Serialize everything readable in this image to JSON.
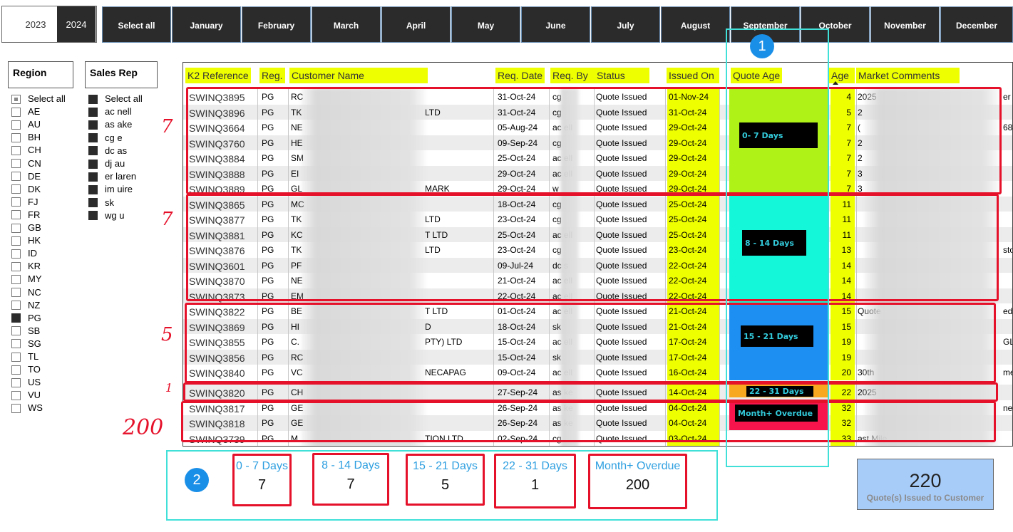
{
  "years": [
    "2023",
    "2024"
  ],
  "selected_year": "2024",
  "months": [
    "Select all",
    "January",
    "February",
    "March",
    "April",
    "May",
    "June",
    "July",
    "August",
    "September",
    "October",
    "November",
    "December"
  ],
  "region": {
    "title": "Region",
    "items": [
      {
        "label": "Select all",
        "state": "part"
      },
      {
        "label": "AE",
        "state": "off"
      },
      {
        "label": "AU",
        "state": "off"
      },
      {
        "label": "BH",
        "state": "off"
      },
      {
        "label": "CH",
        "state": "off"
      },
      {
        "label": "CN",
        "state": "off"
      },
      {
        "label": "DE",
        "state": "off"
      },
      {
        "label": "DK",
        "state": "off"
      },
      {
        "label": "FJ",
        "state": "off"
      },
      {
        "label": "FR",
        "state": "off"
      },
      {
        "label": "GB",
        "state": "off"
      },
      {
        "label": "HK",
        "state": "off"
      },
      {
        "label": "ID",
        "state": "off"
      },
      {
        "label": "KR",
        "state": "off"
      },
      {
        "label": "MY",
        "state": "off"
      },
      {
        "label": "NC",
        "state": "off"
      },
      {
        "label": "NZ",
        "state": "off"
      },
      {
        "label": "PG",
        "state": "on"
      },
      {
        "label": "SB",
        "state": "off"
      },
      {
        "label": "SG",
        "state": "off"
      },
      {
        "label": "TL",
        "state": "off"
      },
      {
        "label": "TO",
        "state": "off"
      },
      {
        "label": "US",
        "state": "off"
      },
      {
        "label": "VU",
        "state": "off"
      },
      {
        "label": "WS",
        "state": "off"
      }
    ]
  },
  "sales_rep": {
    "title": "Sales Rep",
    "items": [
      {
        "label": "Select all",
        "state": "on"
      },
      {
        "label": "ac    nell",
        "state": "on"
      },
      {
        "label": "as    ake",
        "state": "on"
      },
      {
        "label": "cg    e",
        "state": "on"
      },
      {
        "label": "dc    as",
        "state": "on"
      },
      {
        "label": "dj    au",
        "state": "on"
      },
      {
        "label": "er    laren",
        "state": "on"
      },
      {
        "label": "im    uire",
        "state": "on"
      },
      {
        "label": "sk",
        "state": "on"
      },
      {
        "label": "wg    u",
        "state": "on"
      }
    ]
  },
  "table": {
    "headers": {
      "ref": "K2 Reference",
      "reg": "Reg.",
      "customer": "Customer Name",
      "req_date": "Req. Date",
      "req_by": "Req. By",
      "status": "Status",
      "issued_on": "Issued On",
      "quote_age": "Quote Age",
      "age": "Age",
      "comments": "Market Comments"
    },
    "rows": [
      {
        "ref": "SWINQ3895",
        "reg": "PG",
        "cust": "RC",
        "cust_end": "",
        "date": "31-Oct-24",
        "by": "cg",
        "status": "Quote Issued",
        "issued": "01-Nov-24",
        "age": "4",
        "comment": "2025"
      },
      {
        "ref": "SWINQ3896",
        "reg": "PG",
        "cust": "TK",
        "cust_end": "LTD",
        "date": "31-Oct-24",
        "by": "cg",
        "status": "Quote Issued",
        "issued": "31-Oct-24",
        "age": "5",
        "comment": "2"
      },
      {
        "ref": "SWINQ3664",
        "reg": "PG",
        "cust": "NE",
        "cust_end": "",
        "date": "05-Aug-24",
        "by": "ac    ell",
        "status": "Quote Issued",
        "issued": "29-Oct-24",
        "age": "7",
        "comment": "("
      },
      {
        "ref": "SWINQ3760",
        "reg": "PG",
        "cust": "HE",
        "cust_end": "",
        "date": "09-Sep-24",
        "by": "cg",
        "status": "Quote Issued",
        "issued": "29-Oct-24",
        "age": "7",
        "comment": "2"
      },
      {
        "ref": "SWINQ3884",
        "reg": "PG",
        "cust": "SM",
        "cust_end": "",
        "date": "25-Oct-24",
        "by": "ac    ell",
        "status": "Quote Issued",
        "issued": "29-Oct-24",
        "age": "7",
        "comment": "2"
      },
      {
        "ref": "SWINQ3888",
        "reg": "PG",
        "cust": "EI",
        "cust_end": "",
        "date": "29-Oct-24",
        "by": "ac    ell",
        "status": "Quote Issued",
        "issued": "29-Oct-24",
        "age": "7",
        "comment": "3"
      },
      {
        "ref": "SWINQ3889",
        "reg": "PG",
        "cust": "GL",
        "cust_end": "MARK",
        "date": "29-Oct-24",
        "by": "w",
        "status": "Quote Issued",
        "issued": "29-Oct-24",
        "age": "7",
        "comment": "3"
      },
      {
        "ref": "SWINQ3865",
        "reg": "PG",
        "cust": "MC",
        "cust_end": "",
        "date": "18-Oct-24",
        "by": "cg",
        "status": "Quote Issued",
        "issued": "25-Oct-24",
        "age": "11",
        "comment": ""
      },
      {
        "ref": "SWINQ3877",
        "reg": "PG",
        "cust": "TK",
        "cust_end": "LTD",
        "date": "23-Oct-24",
        "by": "cg",
        "status": "Quote Issued",
        "issued": "25-Oct-24",
        "age": "11",
        "comment": ""
      },
      {
        "ref": "SWINQ3881",
        "reg": "PG",
        "cust": "KC",
        "cust_end": "T LTD",
        "date": "25-Oct-24",
        "by": "ac    ell",
        "status": "Quote Issued",
        "issued": "25-Oct-24",
        "age": "11",
        "comment": ""
      },
      {
        "ref": "SWINQ3876",
        "reg": "PG",
        "cust": "TK",
        "cust_end": "LTD",
        "date": "23-Oct-24",
        "by": "cg",
        "status": "Quote Issued",
        "issued": "23-Oct-24",
        "age": "13",
        "comment": ""
      },
      {
        "ref": "SWINQ3601",
        "reg": "PG",
        "cust": "PF",
        "cust_end": "",
        "date": "09-Jul-24",
        "by": "dc    s",
        "status": "Quote Issued",
        "issued": "22-Oct-24",
        "age": "14",
        "comment": ""
      },
      {
        "ref": "SWINQ3870",
        "reg": "PG",
        "cust": "NE",
        "cust_end": "",
        "date": "21-Oct-24",
        "by": "ac    ell",
        "status": "Quote Issued",
        "issued": "22-Oct-24",
        "age": "14",
        "comment": ""
      },
      {
        "ref": "SWINQ3873",
        "reg": "PG",
        "cust": "EM",
        "cust_end": "",
        "date": "22-Oct-24",
        "by": "ac    ell",
        "status": "Quote Issued",
        "issued": "22-Oct-24",
        "age": "14",
        "comment": ""
      },
      {
        "ref": "SWINQ3822",
        "reg": "PG",
        "cust": "BE",
        "cust_end": "T LTD",
        "date": "01-Oct-24",
        "by": "ac    ell",
        "status": "Quote Issued",
        "issued": "21-Oct-24",
        "age": "15",
        "comment": "Quote"
      },
      {
        "ref": "SWINQ3869",
        "reg": "PG",
        "cust": "HI",
        "cust_end": "D",
        "date": "18-Oct-24",
        "by": "sk",
        "status": "Quote Issued",
        "issued": "21-Oct-24",
        "age": "15",
        "comment": ""
      },
      {
        "ref": "SWINQ3855",
        "reg": "PG",
        "cust": "C.",
        "cust_end": "PTY) LTD",
        "date": "15-Oct-24",
        "by": "ac    ell",
        "status": "Quote Issued",
        "issued": "17-Oct-24",
        "age": "19",
        "comment": ""
      },
      {
        "ref": "SWINQ3856",
        "reg": "PG",
        "cust": "RC",
        "cust_end": "",
        "date": "15-Oct-24",
        "by": "sk",
        "status": "Quote Issued",
        "issued": "17-Oct-24",
        "age": "19",
        "comment": ""
      },
      {
        "ref": "SWINQ3840",
        "reg": "PG",
        "cust": "VC",
        "cust_end": "NECAPAG",
        "date": "09-Oct-24",
        "by": "ac    ell",
        "status": "Quote Issued",
        "issued": "16-Oct-24",
        "age": "20",
        "comment": "30th"
      },
      {
        "ref": "SWINQ3820",
        "reg": "PG",
        "cust": "CH",
        "cust_end": "",
        "date": "27-Sep-24",
        "by": "as    ke",
        "status": "Quote Issued",
        "issued": "14-Oct-24",
        "age": "22",
        "comment": "2025"
      },
      {
        "ref": "SWINQ3817",
        "reg": "PG",
        "cust": "GE",
        "cust_end": "",
        "date": "26-Sep-24",
        "by": "as    ke",
        "status": "Quote Issued",
        "issued": "04-Oct-24",
        "age": "32",
        "comment": ""
      },
      {
        "ref": "SWINQ3818",
        "reg": "PG",
        "cust": "GE",
        "cust_end": "",
        "date": "26-Sep-24",
        "by": "as    ke",
        "status": "Quote Issued",
        "issued": "04-Oct-24",
        "age": "32",
        "comment": ""
      },
      {
        "ref": "SWINQ3739",
        "reg": "PG",
        "cust": "M",
        "cust_end": "TION LTD",
        "date": "02-Sep-24",
        "by": "cg",
        "status": "Quote Issued",
        "issued": "03-Oct-24",
        "age": "33",
        "comment": "ast Mile"
      }
    ],
    "edge_text": [
      "er",
      "",
      "68",
      "",
      "",
      "",
      "",
      "",
      "",
      "",
      "sto",
      "",
      "",
      "",
      "ed",
      "",
      "GL",
      "",
      "me",
      "",
      "ne",
      "",
      ""
    ]
  },
  "bands": [
    {
      "label": "0- 7 Days",
      "color": "#aef218"
    },
    {
      "label": "8 - 14 Days",
      "color": "#14f7d8"
    },
    {
      "label": "15 - 21 Days",
      "color": "#1d8ff2"
    },
    {
      "label": "22 - 31 Days",
      "color": "#f7a81e"
    },
    {
      "label": "Month+ Overdue",
      "color": "#f7144c"
    }
  ],
  "annotations": {
    "badge_1": "1",
    "badge_2": "2",
    "tallies": [
      "7",
      "7",
      "5",
      "1",
      "200"
    ]
  },
  "cards": [
    {
      "label": "0 - 7 Days",
      "value": "7"
    },
    {
      "label": "8 - 14 Days",
      "value": "7"
    },
    {
      "label": "15 - 21 Days",
      "value": "5"
    },
    {
      "label": "22 - 31 Days",
      "value": "1"
    },
    {
      "label": "Month+ Overdue",
      "value": "200"
    }
  ],
  "kpi": {
    "value": "220",
    "label": "Quote(s) Issued to Customer"
  },
  "colors": {
    "highlight": "#eeff00",
    "annotation_red": "#e5112a",
    "cyan_box": "#40e0d8",
    "kpi_bg": "#a8ccf8"
  }
}
